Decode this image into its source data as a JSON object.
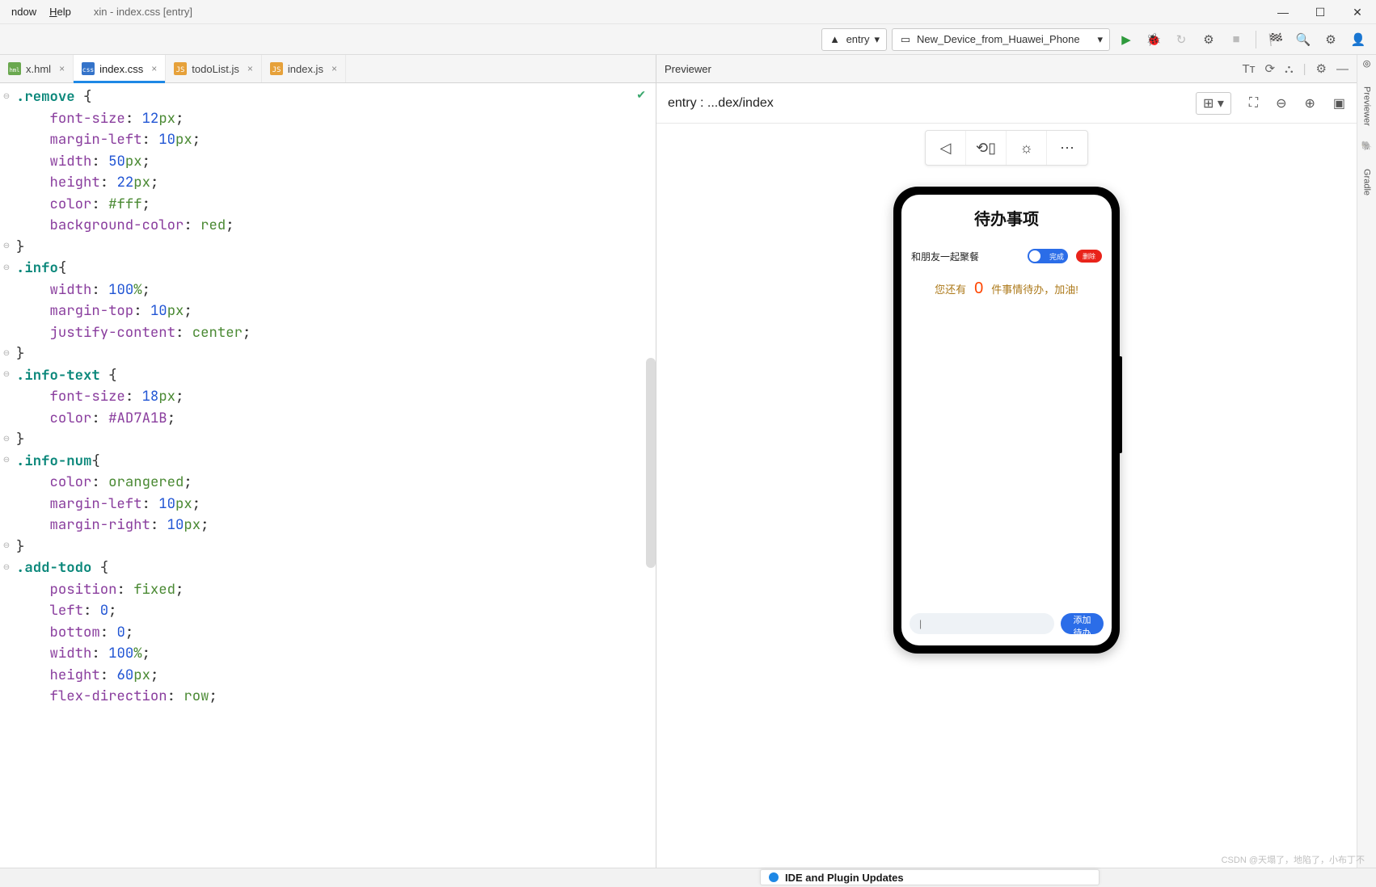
{
  "menubar": {
    "items": [
      "ndow",
      "Help"
    ],
    "window_title": "xin - index.css [entry]"
  },
  "window_controls": {
    "min": "—",
    "max": "☐",
    "close": "✕"
  },
  "toolbar": {
    "module_combo": "entry",
    "device_combo": "New_Device_from_Huawei_Phone"
  },
  "tabs": [
    {
      "name": "x.hml",
      "type": "hml",
      "active": false
    },
    {
      "name": "index.css",
      "type": "css",
      "active": true
    },
    {
      "name": "todoList.js",
      "type": "js",
      "active": false
    },
    {
      "name": "index.js",
      "type": "js",
      "active": false
    }
  ],
  "code_lines": [
    [
      {
        "t": ".remove ",
        "c": "sel"
      },
      {
        "t": "{",
        "c": "brace"
      }
    ],
    [
      {
        "t": "    "
      },
      {
        "t": "font-size",
        "c": "prop"
      },
      {
        "t": ": ",
        "c": "colon"
      },
      {
        "t": "12",
        "c": "num"
      },
      {
        "t": "px",
        "c": "unit"
      },
      {
        "t": ";",
        "c": "semi"
      }
    ],
    [
      {
        "t": "    "
      },
      {
        "t": "margin-left",
        "c": "prop"
      },
      {
        "t": ": ",
        "c": "colon"
      },
      {
        "t": "10",
        "c": "num"
      },
      {
        "t": "px",
        "c": "unit"
      },
      {
        "t": ";",
        "c": "semi"
      }
    ],
    [
      {
        "t": "    "
      },
      {
        "t": "width",
        "c": "prop"
      },
      {
        "t": ": ",
        "c": "colon"
      },
      {
        "t": "50",
        "c": "num"
      },
      {
        "t": "px",
        "c": "unit"
      },
      {
        "t": ";",
        "c": "semi"
      }
    ],
    [
      {
        "t": "    "
      },
      {
        "t": "height",
        "c": "prop"
      },
      {
        "t": ": ",
        "c": "colon"
      },
      {
        "t": "22",
        "c": "num"
      },
      {
        "t": "px",
        "c": "unit"
      },
      {
        "t": ";",
        "c": "semi"
      }
    ],
    [
      {
        "t": "    "
      },
      {
        "t": "color",
        "c": "prop"
      },
      {
        "t": ": ",
        "c": "colon"
      },
      {
        "t": "#fff",
        "c": "val"
      },
      {
        "t": ";",
        "c": "semi"
      }
    ],
    [
      {
        "t": "    "
      },
      {
        "t": "background-color",
        "c": "prop"
      },
      {
        "t": ": ",
        "c": "colon"
      },
      {
        "t": "red",
        "c": "val"
      },
      {
        "t": ";",
        "c": "semi"
      }
    ],
    [
      {
        "t": "}",
        "c": "brace"
      }
    ],
    [
      {
        "t": ".info",
        "c": "sel"
      },
      {
        "t": "{",
        "c": "brace"
      }
    ],
    [
      {
        "t": "    "
      },
      {
        "t": "width",
        "c": "prop"
      },
      {
        "t": ": ",
        "c": "colon"
      },
      {
        "t": "100",
        "c": "num"
      },
      {
        "t": "%",
        "c": "unit"
      },
      {
        "t": ";",
        "c": "semi"
      }
    ],
    [
      {
        "t": "    "
      },
      {
        "t": "margin-top",
        "c": "prop"
      },
      {
        "t": ": ",
        "c": "colon"
      },
      {
        "t": "10",
        "c": "num"
      },
      {
        "t": "px",
        "c": "unit"
      },
      {
        "t": ";",
        "c": "semi"
      }
    ],
    [
      {
        "t": "    "
      },
      {
        "t": "justify-content",
        "c": "prop"
      },
      {
        "t": ": ",
        "c": "colon"
      },
      {
        "t": "center",
        "c": "val"
      },
      {
        "t": ";",
        "c": "semi"
      }
    ],
    [
      {
        "t": "}",
        "c": "brace"
      }
    ],
    [
      {
        "t": ".info-text ",
        "c": "sel"
      },
      {
        "t": "{",
        "c": "brace"
      }
    ],
    [
      {
        "t": "    "
      },
      {
        "t": "font-size",
        "c": "prop"
      },
      {
        "t": ": ",
        "c": "colon"
      },
      {
        "t": "18",
        "c": "num"
      },
      {
        "t": "px",
        "c": "unit"
      },
      {
        "t": ";",
        "c": "semi"
      }
    ],
    [
      {
        "t": "    "
      },
      {
        "t": "color",
        "c": "prop"
      },
      {
        "t": ": ",
        "c": "colon"
      },
      {
        "t": "#AD7A1B",
        "c": "hex"
      },
      {
        "t": ";",
        "c": "semi"
      }
    ],
    [
      {
        "t": "}",
        "c": "brace"
      }
    ],
    [
      {
        "t": ".info-num",
        "c": "sel"
      },
      {
        "t": "{",
        "c": "brace"
      }
    ],
    [
      {
        "t": "    "
      },
      {
        "t": "color",
        "c": "prop"
      },
      {
        "t": ": ",
        "c": "colon"
      },
      {
        "t": "orangered",
        "c": "val"
      },
      {
        "t": ";",
        "c": "semi"
      }
    ],
    [
      {
        "t": "    "
      },
      {
        "t": "margin-left",
        "c": "prop"
      },
      {
        "t": ": ",
        "c": "colon"
      },
      {
        "t": "10",
        "c": "num"
      },
      {
        "t": "px",
        "c": "unit"
      },
      {
        "t": ";",
        "c": "semi"
      }
    ],
    [
      {
        "t": "    "
      },
      {
        "t": "margin-right",
        "c": "prop"
      },
      {
        "t": ": ",
        "c": "colon"
      },
      {
        "t": "10",
        "c": "num"
      },
      {
        "t": "px",
        "c": "unit"
      },
      {
        "t": ";",
        "c": "semi"
      }
    ],
    [
      {
        "t": "}",
        "c": "brace"
      }
    ],
    [
      {
        "t": ".add-todo ",
        "c": "sel"
      },
      {
        "t": "{",
        "c": "brace"
      }
    ],
    [
      {
        "t": "    "
      },
      {
        "t": "position",
        "c": "prop"
      },
      {
        "t": ": ",
        "c": "colon"
      },
      {
        "t": "fixed",
        "c": "val"
      },
      {
        "t": ";",
        "c": "semi"
      }
    ],
    [
      {
        "t": "    "
      },
      {
        "t": "left",
        "c": "prop"
      },
      {
        "t": ": ",
        "c": "colon"
      },
      {
        "t": "0",
        "c": "num"
      },
      {
        "t": ";",
        "c": "semi"
      }
    ],
    [
      {
        "t": "    "
      },
      {
        "t": "bottom",
        "c": "prop"
      },
      {
        "t": ": ",
        "c": "colon"
      },
      {
        "t": "0",
        "c": "num"
      },
      {
        "t": ";",
        "c": "semi"
      }
    ],
    [
      {
        "t": "    "
      },
      {
        "t": "width",
        "c": "prop"
      },
      {
        "t": ": ",
        "c": "colon"
      },
      {
        "t": "100",
        "c": "num"
      },
      {
        "t": "%",
        "c": "unit"
      },
      {
        "t": ";",
        "c": "semi"
      }
    ],
    [
      {
        "t": "    "
      },
      {
        "t": "height",
        "c": "prop"
      },
      {
        "t": ": ",
        "c": "colon"
      },
      {
        "t": "60",
        "c": "num"
      },
      {
        "t": "px",
        "c": "unit"
      },
      {
        "t": ";",
        "c": "semi"
      }
    ],
    [
      {
        "t": "    "
      },
      {
        "t": "flex-direction",
        "c": "prop"
      },
      {
        "t": ": ",
        "c": "colon"
      },
      {
        "t": "row",
        "c": "val"
      },
      {
        "t": ";",
        "c": "semi"
      }
    ]
  ],
  "fold_offsets": [
    0,
    7,
    8,
    12,
    13,
    16,
    17,
    21,
    22
  ],
  "previewer": {
    "title": "Previewer",
    "route_label": "entry : ...dex/index",
    "side_tabs": [
      "Previewer",
      "Gradle"
    ]
  },
  "app": {
    "title": "待办事项",
    "todo_text": "和朋友一起聚餐",
    "switch_label": "完成",
    "delete_label": "删除",
    "info_pre": "您还有",
    "info_num": "0",
    "info_post": "件事情待办，加油!",
    "input_placeholder": "|",
    "add_btn": "添加待办"
  },
  "notification": {
    "text": "IDE and Plugin Updates"
  },
  "watermark": "CSDN @天塌了，地陷了，小布丁不"
}
